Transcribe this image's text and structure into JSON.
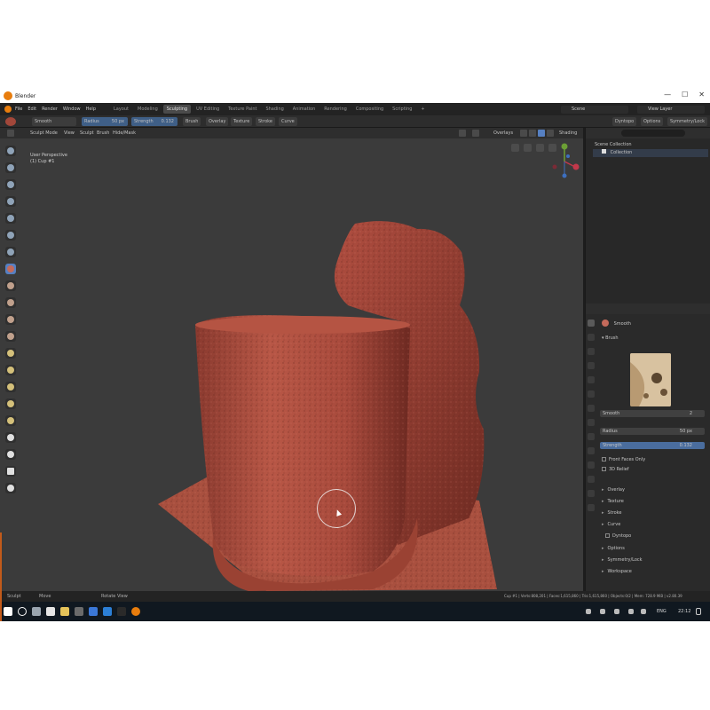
{
  "window": {
    "title": "Blender",
    "controls": [
      "—",
      "☐",
      "✕"
    ]
  },
  "menu": {
    "items": [
      "File",
      "Edit",
      "Render",
      "Window",
      "Help"
    ]
  },
  "workspaces": [
    {
      "label": "Layout",
      "active": false
    },
    {
      "label": "Modeling",
      "active": false
    },
    {
      "label": "Sculpting",
      "active": true
    },
    {
      "label": "UV Editing",
      "active": false
    },
    {
      "label": "Texture Paint",
      "active": false
    },
    {
      "label": "Shading",
      "active": false
    },
    {
      "label": "Animation",
      "active": false
    },
    {
      "label": "Rendering",
      "active": false
    },
    {
      "label": "Compositing",
      "active": false
    },
    {
      "label": "Scripting",
      "active": false
    }
  ],
  "add_workspace": "+",
  "scene": {
    "label": "Scene",
    "view_layer": "View Layer"
  },
  "tool_settings": {
    "brush_name": "Smooth",
    "radius_label": "Radius",
    "radius_value": "50 px",
    "strength_label": "Strength",
    "strength_value": "0.132",
    "menus": [
      "Brush",
      "Overlay",
      "Texture",
      "Stroke",
      "Curve"
    ],
    "right_menus": [
      "Dyntopo",
      "Options",
      "Symmetry/Lock"
    ]
  },
  "viewport": {
    "header": [
      "Sculpt Mode",
      "View",
      "Sculpt",
      "Brush",
      "Hide/Mask"
    ],
    "overlays_label": "Overlays",
    "shading_label": "Shading",
    "info_line1": "User Perspective",
    "info_line2": "(1) Cup #1"
  },
  "colors": {
    "clay": "#a2473a",
    "clay_dark": "#7a2f25",
    "clay_light": "#c0604f",
    "viewport_bg": "#3b3b3b",
    "accent": "#5680c2"
  },
  "outliner": {
    "title": "Scene Collection",
    "collection": "Collection"
  },
  "properties": {
    "brush_name": "Smooth",
    "brush_section": "Brush",
    "brush_field": "Smooth",
    "users": "2",
    "radius_label": "Radius",
    "radius_value": "50 px",
    "strength_label": "Strength",
    "strength_value": "0.132",
    "front_faces": "Front Faces Only",
    "relief": "3D Relief",
    "sections": [
      "Overlay",
      "Texture",
      "Stroke",
      "Curve",
      "Dyntopo",
      "Options",
      "Symmetry/Lock",
      "Workspace"
    ]
  },
  "statusbar": {
    "sculpt": "Sculpt",
    "move": "Move",
    "rotate": "Rotate View",
    "stats": "Cup #1 | Verts:808,201 | Faces:1,615,860 | Tris:1,615,860 | Objects:0/2 | Mem: 728.9 MiB | v2.80.39"
  },
  "taskbar": {
    "lang": "ENG",
    "time": "22:12"
  }
}
